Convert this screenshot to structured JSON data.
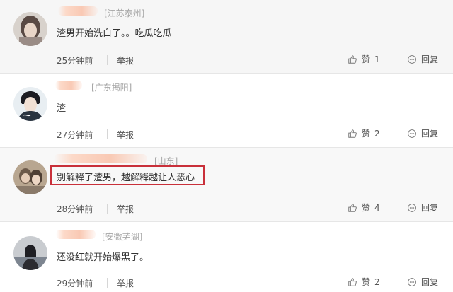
{
  "comments": [
    {
      "location": "[江苏泰州]",
      "text": "渣男开始洗白了。。吃瓜吃瓜",
      "time": "25分钟前",
      "report": "举报",
      "like_label": "赞",
      "likes": "1",
      "reply_label": "回复",
      "highlighted": false
    },
    {
      "location": "[广东揭阳]",
      "text": "渣",
      "time": "27分钟前",
      "report": "举报",
      "like_label": "赞",
      "likes": "2",
      "reply_label": "回复",
      "highlighted": false
    },
    {
      "location": "[山东]",
      "text": "别解释了渣男，越解释越让人恶心",
      "time": "28分钟前",
      "report": "举报",
      "like_label": "赞",
      "likes": "4",
      "reply_label": "回复",
      "highlighted": true
    },
    {
      "location": "[安徽芜湖]",
      "text": "还没红就开始爆黑了。",
      "time": "29分钟前",
      "report": "举报",
      "like_label": "赞",
      "likes": "2",
      "reply_label": "回复",
      "highlighted": false
    }
  ],
  "colors": {
    "highlight_border": "#c9303a",
    "location_text": "#a6a6a6",
    "username_blur": "#f9c9b4"
  },
  "icons": {
    "like": "thumbs-up-icon",
    "reply": "speech-bubble-icon"
  }
}
